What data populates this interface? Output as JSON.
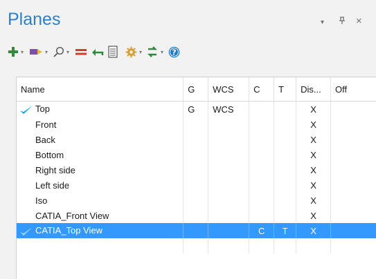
{
  "panel": {
    "title": "Planes",
    "dropdown_glyph": "▾",
    "pin_glyph": "ᵽ",
    "close_glyph": "×"
  },
  "toolbar": {
    "icons": [
      "add-icon",
      "select-icon",
      "search-icon",
      "equals-icon",
      "undo-icon",
      "properties-icon",
      "settings-icon",
      "refresh-icon",
      "help-icon"
    ],
    "dropdown_arrow": "▾"
  },
  "colors": {
    "title": "#2e80c9",
    "selection": "#3399ff",
    "check": "#1aa4e8",
    "add_green": "#2e8b3a",
    "equals_red": "#d33b2f"
  },
  "table": {
    "columns": [
      "Name",
      "G",
      "WCS",
      "C",
      "T",
      "Dis...",
      "Off"
    ],
    "rows": [
      {
        "checked": true,
        "name": "Top",
        "g": "G",
        "wcs": "WCS",
        "c": "",
        "t": "",
        "dis": "X",
        "off": "",
        "selected": false
      },
      {
        "checked": false,
        "name": "Front",
        "g": "",
        "wcs": "",
        "c": "",
        "t": "",
        "dis": "X",
        "off": "",
        "selected": false
      },
      {
        "checked": false,
        "name": "Back",
        "g": "",
        "wcs": "",
        "c": "",
        "t": "",
        "dis": "X",
        "off": "",
        "selected": false
      },
      {
        "checked": false,
        "name": "Bottom",
        "g": "",
        "wcs": "",
        "c": "",
        "t": "",
        "dis": "X",
        "off": "",
        "selected": false
      },
      {
        "checked": false,
        "name": "Right side",
        "g": "",
        "wcs": "",
        "c": "",
        "t": "",
        "dis": "X",
        "off": "",
        "selected": false
      },
      {
        "checked": false,
        "name": "Left side",
        "g": "",
        "wcs": "",
        "c": "",
        "t": "",
        "dis": "X",
        "off": "",
        "selected": false
      },
      {
        "checked": false,
        "name": "Iso",
        "g": "",
        "wcs": "",
        "c": "",
        "t": "",
        "dis": "X",
        "off": "",
        "selected": false
      },
      {
        "checked": false,
        "name": "CATIA_Front View",
        "g": "",
        "wcs": "",
        "c": "",
        "t": "",
        "dis": "X",
        "off": "",
        "selected": false
      },
      {
        "checked": true,
        "name": "CATIA_Top View",
        "g": "",
        "wcs": "",
        "c": "C",
        "t": "T",
        "dis": "X",
        "off": "",
        "selected": true
      }
    ]
  }
}
